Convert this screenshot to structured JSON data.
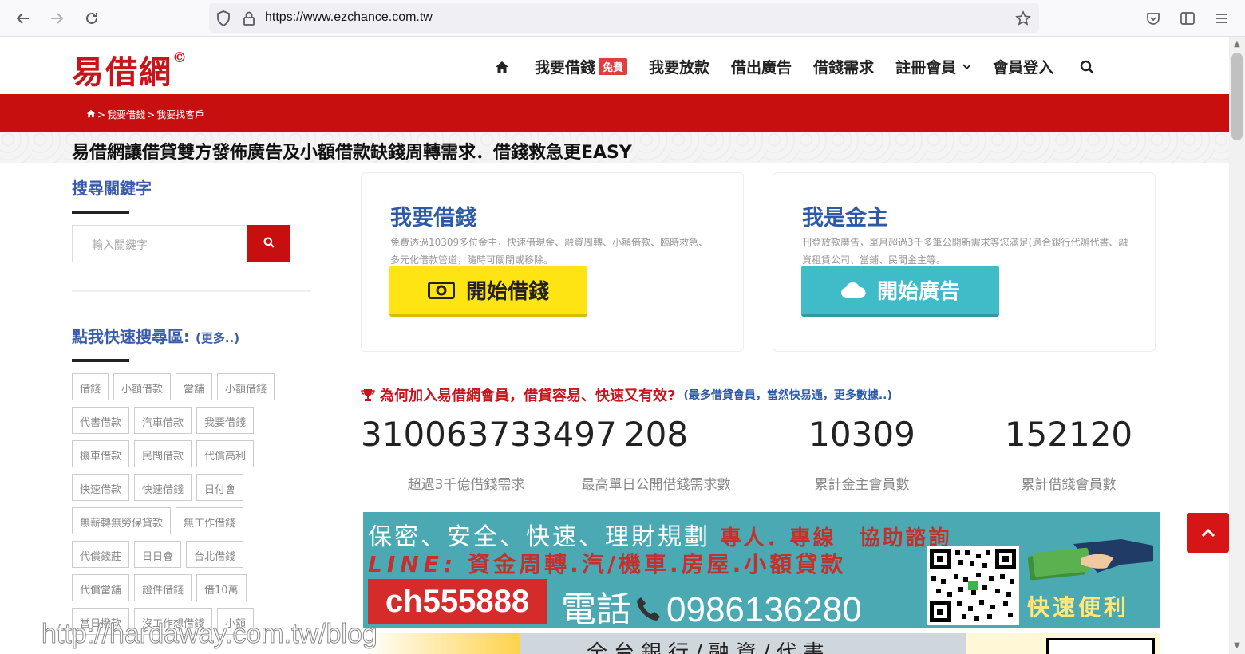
{
  "browser": {
    "url": "https://www.ezchance.com.tw"
  },
  "site": {
    "logo_text": "易借網",
    "logo_mark": "©"
  },
  "topnav": {
    "borrow": "我要借錢",
    "borrow_badge": "免費",
    "lend": "我要放款",
    "lend_ad": "借出廣告",
    "needs": "借錢需求",
    "register": "註冊會員",
    "login": "會員登入"
  },
  "breadcrumb": {
    "sep1": ">",
    "crumb1": "我要借錢",
    "sep2": ">",
    "crumb2": "我要找客戶"
  },
  "slogan": "易借網讓借貸雙方發佈廣告及小額借款缺錢周轉需求．借錢救急更EASY",
  "sidebar": {
    "search_heading": "搜尋關鍵字",
    "search_placeholder": "輸入關鍵字",
    "quick_heading": "點我快速搜尋區:",
    "quick_more": "(更多..)",
    "tags": [
      "借錢",
      "小額借款",
      "當舖",
      "小額借錢",
      "代書借款",
      "汽車借款",
      "我要借錢",
      "機車借款",
      "民間借款",
      "代償高利",
      "快速借款",
      "快速借錢",
      "日付會",
      "無薪轉無勞保貸款",
      "無工作借錢",
      "代償錢莊",
      "日日會",
      "台北借錢",
      "代償當舖",
      "證件借錢",
      "借10萬",
      "當日撥款",
      "沒工作想借錢",
      "小額"
    ]
  },
  "cards": {
    "borrow": {
      "title": "我要借錢",
      "desc": "免費透過10309多位金主，快速借現金、融資周轉、小額借款、臨時救急、多元化借款管道，隨時可關閉或移除。",
      "button": "開始借錢"
    },
    "lender": {
      "title": "我是金主",
      "desc": "刊登放款廣告，單月超過3千多筆公開新需求等您滿足(適合銀行代辦代書、融資租賃公司、當鋪、民間金主等。",
      "button": "開始廣告"
    }
  },
  "why": {
    "text": "為何加入易借網會員，借貸容易、快速又有效?",
    "more": "(最多借貸會員，當然快易通，更多數據..)"
  },
  "stats": [
    {
      "value": "310063733497",
      "label": "超過3千億借錢需求"
    },
    {
      "value": "208",
      "label": "最高單日公開借錢需求數"
    },
    {
      "value": "10309",
      "label": "累計金主會員數"
    },
    {
      "value": "152120",
      "label": "累計借錢會員數"
    }
  ],
  "banner": {
    "line1": "保密、安全、快速、理財規劃",
    "line1_highlight": "專人．專線　協助諮詢",
    "line_label": "LINE:",
    "services": "資金周轉.汽/機車.房屋.小額貸款",
    "line_id": "ch555888",
    "phone_label": "電話",
    "phone": "0986136280",
    "fast": "快速便利"
  },
  "banner2": {
    "text": "全台銀行/融資/代書"
  },
  "watermark": "http://hardaway.com.tw/blog",
  "colors": {
    "brand_red": "#c80f0f",
    "title_blue": "#2d5aa8",
    "borrow_button": "#ffe414",
    "ad_button": "#3fbcc7",
    "banner_teal": "#4ba9b4"
  }
}
